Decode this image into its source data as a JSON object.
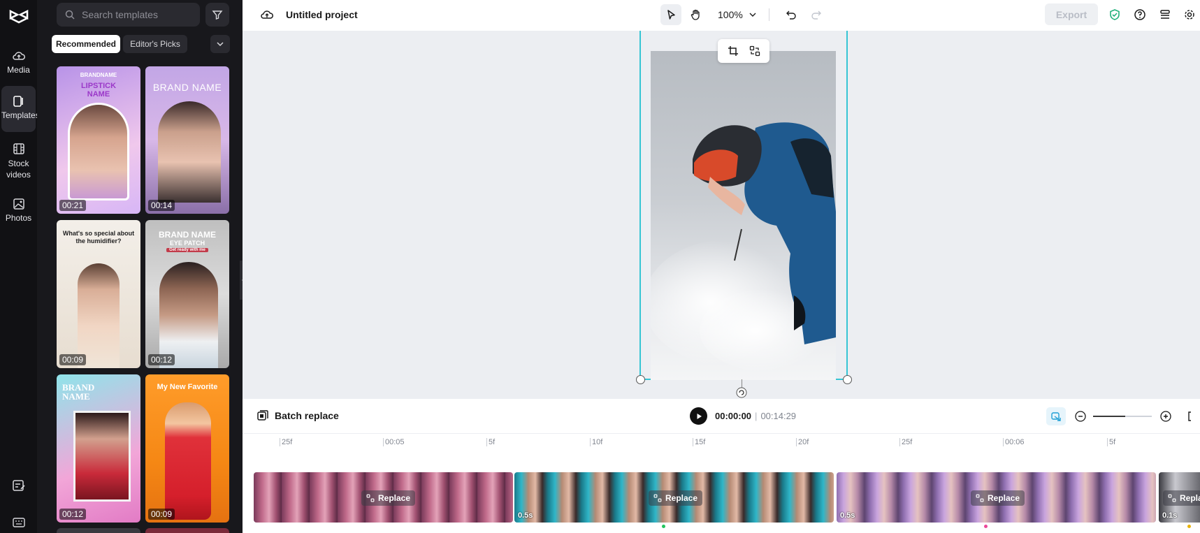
{
  "rail": {
    "items": [
      {
        "label": "Media",
        "icon": "cloud-media-icon"
      },
      {
        "label": "Templates",
        "icon": "templates-icon"
      },
      {
        "label": "Stock videos",
        "icon": "film-icon"
      },
      {
        "label": "Photos",
        "icon": "photo-icon"
      }
    ]
  },
  "panel": {
    "search_placeholder": "Search templates",
    "chips": [
      "Recommended",
      "Editor's Picks"
    ],
    "templates": [
      {
        "duration": "00:21",
        "caption": "LIPSTICK NAME",
        "tag": "BRANDNAME"
      },
      {
        "duration": "00:14",
        "caption": "BRAND NAME"
      },
      {
        "duration": "00:09",
        "caption": "What's so special about the humidifier?"
      },
      {
        "duration": "00:12",
        "caption": "BRAND NAME",
        "sub": "EYE PATCH",
        "tagline": "Get ready with me"
      },
      {
        "duration": "00:12",
        "caption": "BRAND NAME"
      },
      {
        "duration": "00:09",
        "caption": "My New Favorite"
      }
    ]
  },
  "topbar": {
    "title": "Untitled project",
    "zoom": "100%",
    "export_label": "Export"
  },
  "player": {
    "batch_label": "Batch replace",
    "current": "00:00:00",
    "total": "00:14:29"
  },
  "ruler": {
    "ticks": [
      "25f",
      "00:05",
      "5f",
      "10f",
      "15f",
      "20f",
      "25f",
      "00:06",
      "5f"
    ]
  },
  "track": {
    "replace_label": "Replace",
    "clips": [
      {
        "duration": ""
      },
      {
        "duration": "0.5s"
      },
      {
        "duration": "0.5s"
      },
      {
        "duration": "0.1s"
      }
    ]
  },
  "colors": {
    "selection": "#36c5d4",
    "rail_bg": "#111114",
    "panel_bg": "#18181c",
    "canvas_bg": "#eceef2"
  }
}
